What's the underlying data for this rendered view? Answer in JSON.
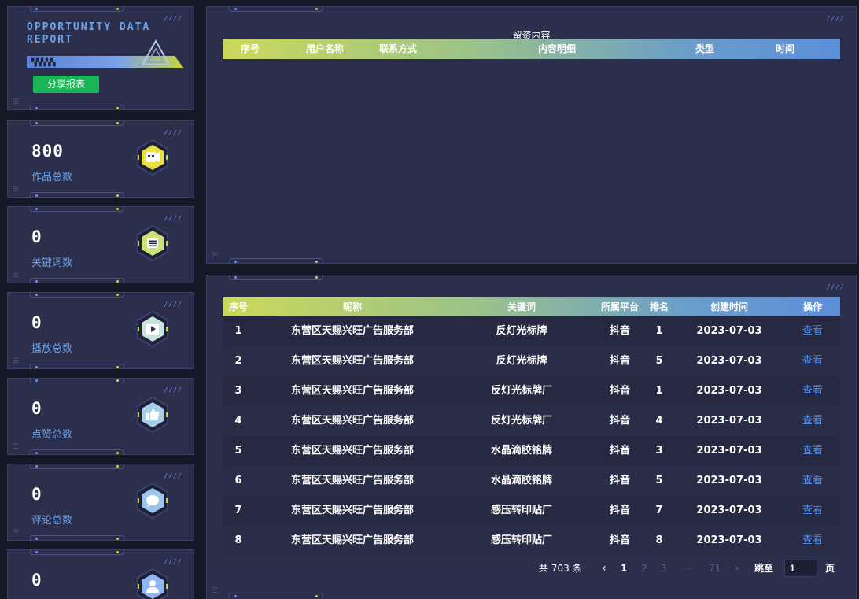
{
  "logo": {
    "title": "OPPORTUNITY DATA REPORT",
    "share_label": "分享报表"
  },
  "stats": [
    {
      "value": "800",
      "label": "作品总数",
      "icon": "video-camera-icon",
      "color": "#e8e040"
    },
    {
      "value": "0",
      "label": "关键词数",
      "icon": "list-icon",
      "color": "#cde07a"
    },
    {
      "value": "0",
      "label": "播放总数",
      "icon": "play-icon",
      "color": "#c7e4dc"
    },
    {
      "value": "0",
      "label": "点赞总数",
      "icon": "thumbs-up-icon",
      "color": "#a7d0e8"
    },
    {
      "value": "0",
      "label": "评论总数",
      "icon": "comment-icon",
      "color": "#9cc4ee"
    },
    {
      "value": "0",
      "label": "",
      "icon": "user-icon",
      "color": "#8eb6f2"
    }
  ],
  "leads_table": {
    "title": "留资内容",
    "columns": [
      "序号",
      "用户名称",
      "联系方式",
      "内容明细",
      "类型",
      "时间"
    ],
    "rows": []
  },
  "rank_table": {
    "columns": [
      "序号",
      "昵称",
      "关键词",
      "所属平台",
      "排名",
      "创建时间",
      "操作"
    ],
    "rows": [
      {
        "no": "1",
        "name": "东营区天赐兴旺广告服务部",
        "keyword": "反灯光标牌",
        "platform": "抖音",
        "rank": "1",
        "date": "2023-07-03",
        "action": "查看"
      },
      {
        "no": "2",
        "name": "东营区天赐兴旺广告服务部",
        "keyword": "反灯光标牌",
        "platform": "抖音",
        "rank": "5",
        "date": "2023-07-03",
        "action": "查看"
      },
      {
        "no": "3",
        "name": "东营区天赐兴旺广告服务部",
        "keyword": "反灯光标牌厂",
        "platform": "抖音",
        "rank": "1",
        "date": "2023-07-03",
        "action": "查看"
      },
      {
        "no": "4",
        "name": "东营区天赐兴旺广告服务部",
        "keyword": "反灯光标牌厂",
        "platform": "抖音",
        "rank": "4",
        "date": "2023-07-03",
        "action": "查看"
      },
      {
        "no": "5",
        "name": "东营区天赐兴旺广告服务部",
        "keyword": "水晶滴胶铭牌",
        "platform": "抖音",
        "rank": "3",
        "date": "2023-07-03",
        "action": "查看"
      },
      {
        "no": "6",
        "name": "东营区天赐兴旺广告服务部",
        "keyword": "水晶滴胶铭牌",
        "platform": "抖音",
        "rank": "5",
        "date": "2023-07-03",
        "action": "查看"
      },
      {
        "no": "7",
        "name": "东营区天赐兴旺广告服务部",
        "keyword": "感压转印贴厂",
        "platform": "抖音",
        "rank": "7",
        "date": "2023-07-03",
        "action": "查看"
      },
      {
        "no": "8",
        "name": "东营区天赐兴旺广告服务部",
        "keyword": "感压转印贴厂",
        "platform": "抖音",
        "rank": "8",
        "date": "2023-07-03",
        "action": "查看"
      }
    ]
  },
  "pagination": {
    "total": "共 703 条",
    "prev": "‹",
    "pages": [
      "1",
      "2",
      "3",
      "···",
      "71"
    ],
    "next": "›",
    "goto_label": "跳至",
    "goto_value": "1",
    "page_suffix": "页"
  }
}
